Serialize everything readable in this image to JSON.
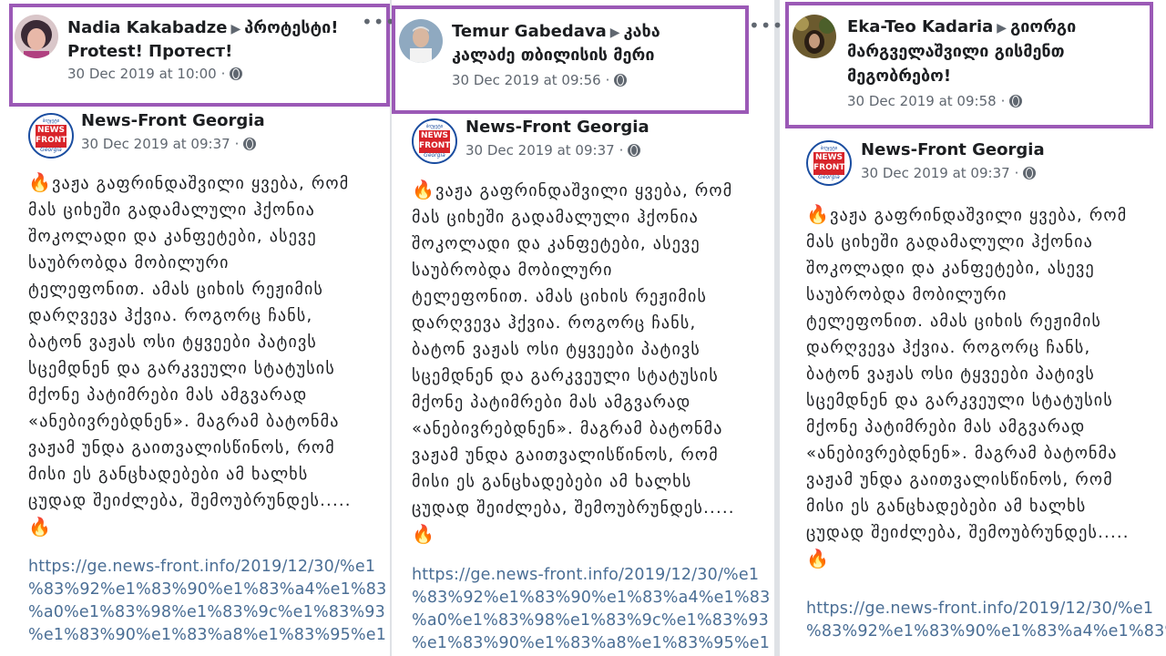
{
  "columns": [
    {
      "sharer": {
        "name": "Nadia Kakabadze",
        "group_line1": "პროტესტი!",
        "group_line2": "Protest! Протест!",
        "timestamp": "30 Dec 2019 at 10:00",
        "separator": "·"
      },
      "original": {
        "page": "News-Front Georgia",
        "timestamp": "30 Dec 2019 at 09:37",
        "separator": "·"
      },
      "link_lines": [
        "https://ge.news-front.info/2019/12/30/%e1",
        "%83%92%e1%83%90%e1%83%a4%e1%83",
        "%a0%e1%83%98%e1%83%9c%e1%83%93",
        "%e1%83%90%e1%83%a8%e1%83%95%e1"
      ]
    },
    {
      "sharer": {
        "name": "Temur Gabedava",
        "group_line1": "კახა",
        "group_line2": "კალაძე თბილისის მერი",
        "timestamp": "30 Dec 2019 at 09:56",
        "separator": "·"
      },
      "original": {
        "page": "News-Front Georgia",
        "timestamp": "30 Dec 2019 at 09:37",
        "separator": "·"
      },
      "link_lines": [
        "https://ge.news-front.info/2019/12/30/%e1",
        "%83%92%e1%83%90%e1%83%a4%e1%83",
        "%a0%e1%83%98%e1%83%9c%e1%83%93",
        "%e1%83%90%e1%83%a8%e1%83%95%e1"
      ]
    },
    {
      "sharer": {
        "name": "Eka-Teo Kadaria",
        "group_line1": "გიორგი",
        "group_line2": "მარგველაშვილი გისმენთ",
        "group_line3": "მეგობრებო!",
        "timestamp": "30 Dec 2019 at 09:58",
        "separator": "·"
      },
      "original": {
        "page": "News-Front Georgia",
        "timestamp": "30 Dec 2019 at 09:37",
        "separator": "·"
      },
      "link_lines": [
        "https://ge.news-front.info/2019/12/30/%e1",
        "%83%92%e1%83%90%e1%83%a4%e1%83%"
      ]
    }
  ],
  "logo": {
    "top": "ბიუჯეტი",
    "mid": "NEWS FRONT",
    "bot": "Georgia"
  },
  "fire": "🔥",
  "more": "•••",
  "post_lines_a": [
    "ვაჟა გაფრინდაშვილი ყვება, რომ",
    "მას ციხეში გადამალული ჰქონია",
    "შოკოლადი და კანფეტები, ასევე",
    "საუბრობდა მობილური",
    "ტელეფონით. ამას ციხის რეჟიმის",
    "დარღვევა ჰქვია. როგორც ჩანს,",
    "ბატონ ვაჟას ოსი ტყვეები პატივს",
    "სცემდნენ და გარკვეული სტატუსის",
    "მქონე პატიმრები მას ამგვარად",
    "«ანებივრებდნენ». მაგრამ ბატონმა",
    "ვაჟამ უნდა გაითვალისწინოს, რომ",
    "მისი ეს განცხადებები ამ ხალხს",
    "ცუდად შეიძლება, შემოუბრუნდეს....."
  ],
  "post_lines_b": [
    "ვაჟა გაფრინდაშვილი ყვება, რომ",
    "მას ციხეში გადამალული ჰქონია",
    "შოკოლადი და კანფეტები, ასევე",
    "საუბრობდა მობილური",
    "ტელეფონით. ამას ციხის რეჟიმის",
    "დარღვევა ჰქვია. როგორც ჩანს,",
    "ბატონ ვაჟას ოსი ტყვეები პატივს",
    "სცემდნენ და გარკვეული სტატუსის",
    "მქონე პატიმრები მას ამგვარად",
    "«ანებივრებდნენ». მაგრამ ბატონმა",
    "ვაჟამ უნდა გაითვალისწინოს, რომ",
    "მისი ეს განცხადებები ამ ხალხს",
    "ცუდად შეიძლება, შემოუბრუნდეს....."
  ],
  "colors": {
    "highlight_border": "#9b59b6",
    "link": "#4a6e95",
    "text": "#1c1e21",
    "muted": "#606770"
  }
}
